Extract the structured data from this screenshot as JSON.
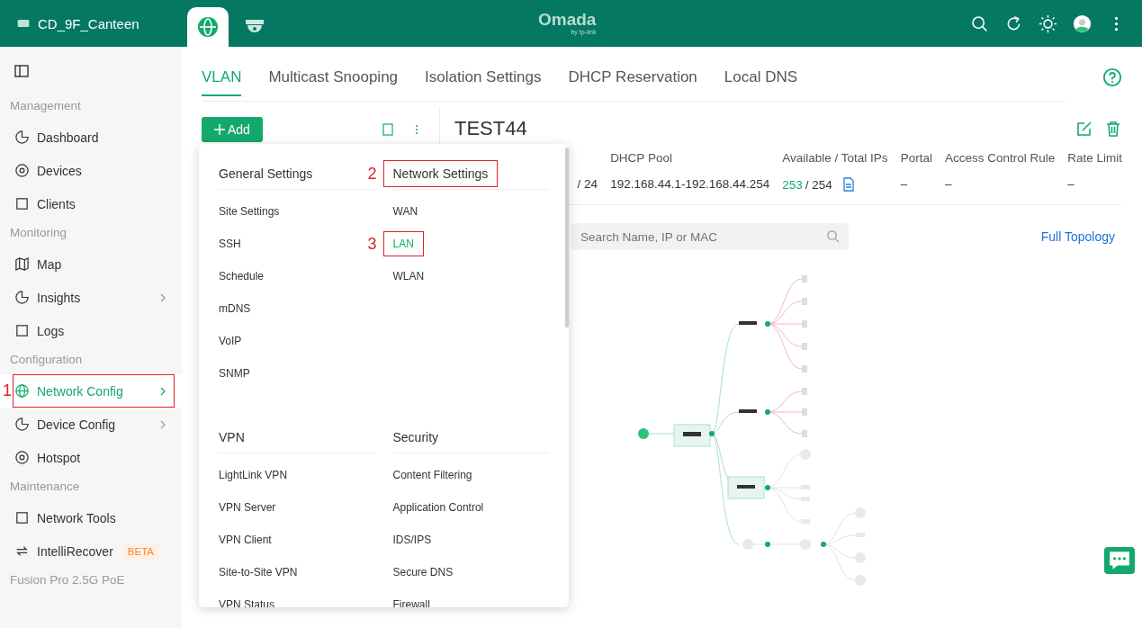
{
  "header": {
    "site_name": "CD_9F_Canteen",
    "tabs": [
      {
        "kind": "network",
        "selected": true
      },
      {
        "kind": "camera",
        "selected": false
      }
    ],
    "logo": "Omada",
    "logo_sub": "by tp-link"
  },
  "sidebar": {
    "groups": [
      {
        "title": "Management",
        "items": [
          {
            "label": "Dashboard",
            "selected": false,
            "submenu": false
          },
          {
            "label": "Devices",
            "selected": false,
            "submenu": false
          },
          {
            "label": "Clients",
            "selected": false,
            "submenu": false
          }
        ]
      },
      {
        "title": "Monitoring",
        "items": [
          {
            "label": "Map",
            "selected": false,
            "submenu": false
          },
          {
            "label": "Insights",
            "selected": false,
            "submenu": true
          },
          {
            "label": "Logs",
            "selected": false,
            "submenu": false
          }
        ]
      },
      {
        "title": "Configuration",
        "items": [
          {
            "label": "Network Config",
            "selected": true,
            "submenu": true,
            "annotation": "1"
          },
          {
            "label": "Device Config",
            "selected": false,
            "submenu": true
          },
          {
            "label": "Hotspot",
            "selected": false,
            "submenu": false
          }
        ]
      },
      {
        "title": "Maintenance",
        "items": [
          {
            "label": "Network Tools",
            "selected": false,
            "submenu": false
          },
          {
            "label": "IntelliRecover",
            "selected": false,
            "submenu": false,
            "badge": "BETA"
          }
        ]
      },
      {
        "title": "Fusion Pro 2.5G PoE"
      }
    ]
  },
  "tabs": [
    {
      "label": "VLAN",
      "selected": true
    },
    {
      "label": "Multicast Snooping",
      "selected": false
    },
    {
      "label": "Isolation Settings",
      "selected": false
    },
    {
      "label": "DHCP Reservation",
      "selected": false
    },
    {
      "label": "Local DNS",
      "selected": false
    }
  ],
  "add_button": "Add",
  "vlan": {
    "title": "TEST44",
    "columns": [
      {
        "value": "/ 24"
      },
      {
        "header": "DHCP Pool",
        "value": "192.168.44.1-192.168.44.254"
      },
      {
        "header": "Available / Total IPs",
        "available": "253",
        "total": "/ 254"
      },
      {
        "header": "Portal",
        "value": "–"
      },
      {
        "header": "Access Control Rule",
        "value": "–"
      },
      {
        "header": "Rate Limit",
        "value": "–"
      }
    ]
  },
  "search": {
    "placeholder": "Search Name, IP or MAC"
  },
  "full_topology": "Full Topology",
  "menu": {
    "sections": [
      {
        "title": "General Settings",
        "items": [
          {
            "label": "Site Settings",
            "selected": false
          },
          {
            "label": "SSH",
            "selected": false
          },
          {
            "label": "Schedule",
            "selected": false
          },
          {
            "label": "mDNS",
            "selected": false
          },
          {
            "label": "VoIP",
            "selected": false
          },
          {
            "label": "SNMP",
            "selected": false
          }
        ]
      },
      {
        "title": "Network Settings",
        "annotation": "2",
        "items": [
          {
            "label": "WAN",
            "selected": false
          },
          {
            "label": "LAN",
            "selected": true,
            "annotation": "3"
          },
          {
            "label": "WLAN",
            "selected": false
          }
        ]
      },
      {
        "title": "VPN",
        "items": [
          {
            "label": "LightLink VPN",
            "selected": false
          },
          {
            "label": "VPN Server",
            "selected": false
          },
          {
            "label": "VPN Client",
            "selected": false
          },
          {
            "label": "Site-to-Site VPN",
            "selected": false
          },
          {
            "label": "VPN Status",
            "selected": false
          }
        ]
      },
      {
        "title": "Security",
        "items": [
          {
            "label": "Content Filtering",
            "selected": false
          },
          {
            "label": "Application Control",
            "selected": false
          },
          {
            "label": "IDS/IPS",
            "selected": false
          },
          {
            "label": "Secure DNS",
            "selected": false
          },
          {
            "label": "Firewall",
            "selected": false
          }
        ]
      }
    ]
  }
}
